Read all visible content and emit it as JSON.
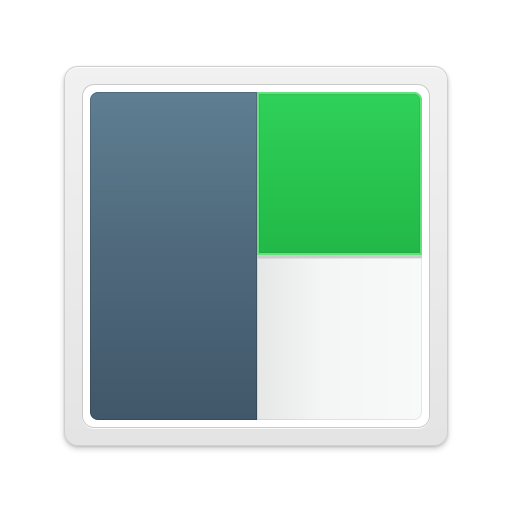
{
  "icon": {
    "name": "split-view-layout-icon",
    "colors": {
      "frame": "#e9e9e9",
      "left_panel": "#4f6a7c",
      "top_right_panel": "#27c24e",
      "bottom_right_panel": "#f3f4f4"
    }
  }
}
